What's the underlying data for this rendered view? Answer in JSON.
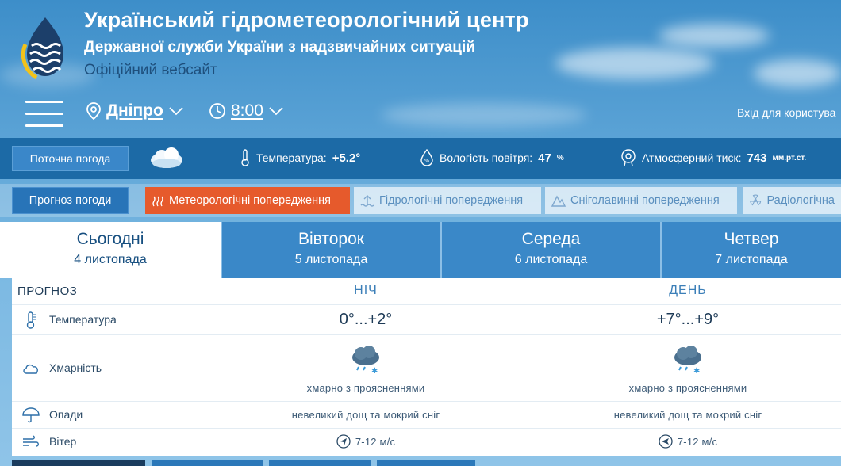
{
  "header": {
    "title": "Український гідрометеорологічний центр",
    "subtitle": "Державної служби України з надзвичайних ситуацій",
    "tagline": "Офіційний вебсайт"
  },
  "nav": {
    "city": "Дніпро",
    "time": "8:00",
    "login": "Вхід для користува"
  },
  "current": {
    "button": "Поточна погода",
    "temperature_label": "Температура:",
    "temperature_value": "+5.2°",
    "humidity_label": "Вологість повітря:",
    "humidity_value": "47",
    "humidity_unit": "%",
    "pressure_label": "Атмосферний тиск:",
    "pressure_value": "743",
    "pressure_unit": "мм.рт.ст."
  },
  "tabs": {
    "forecast": "Прогноз погоди",
    "meteo": "Метеорологічні попередження",
    "hydro": "Гідрологічні попередження",
    "avalanche": "Сніголавинні попередження",
    "radio": "Радіологічна"
  },
  "days": [
    {
      "name": "Сьогодні",
      "date": "4 листопада"
    },
    {
      "name": "Вівторок",
      "date": "5 листопада"
    },
    {
      "name": "Середа",
      "date": "6 листопада"
    },
    {
      "name": "Четвер",
      "date": "7 листопада"
    }
  ],
  "forecast": {
    "heading": "ПРОГНОЗ",
    "night_label": "НІЧ",
    "day_label": "ДЕНЬ",
    "rows": {
      "temperature": {
        "label": "Температура",
        "night": "0°...+2°",
        "day": "+7°...+9°"
      },
      "cloudiness": {
        "label": "Хмарність",
        "night": "хмарно з проясненнями",
        "day": "хмарно з проясненнями"
      },
      "precipitation": {
        "label": "Опади",
        "night": "невеликий дощ та мокрий сніг",
        "day": "невеликий дощ та мокрий сніг"
      },
      "wind": {
        "label": "Вітер",
        "night": "7-12 м/с",
        "day": "7-12 м/с"
      }
    }
  },
  "colors": {
    "accent_orange": "#e65a2c",
    "band_blue": "#1c6aa6",
    "text_dark": "#1e3b57"
  }
}
